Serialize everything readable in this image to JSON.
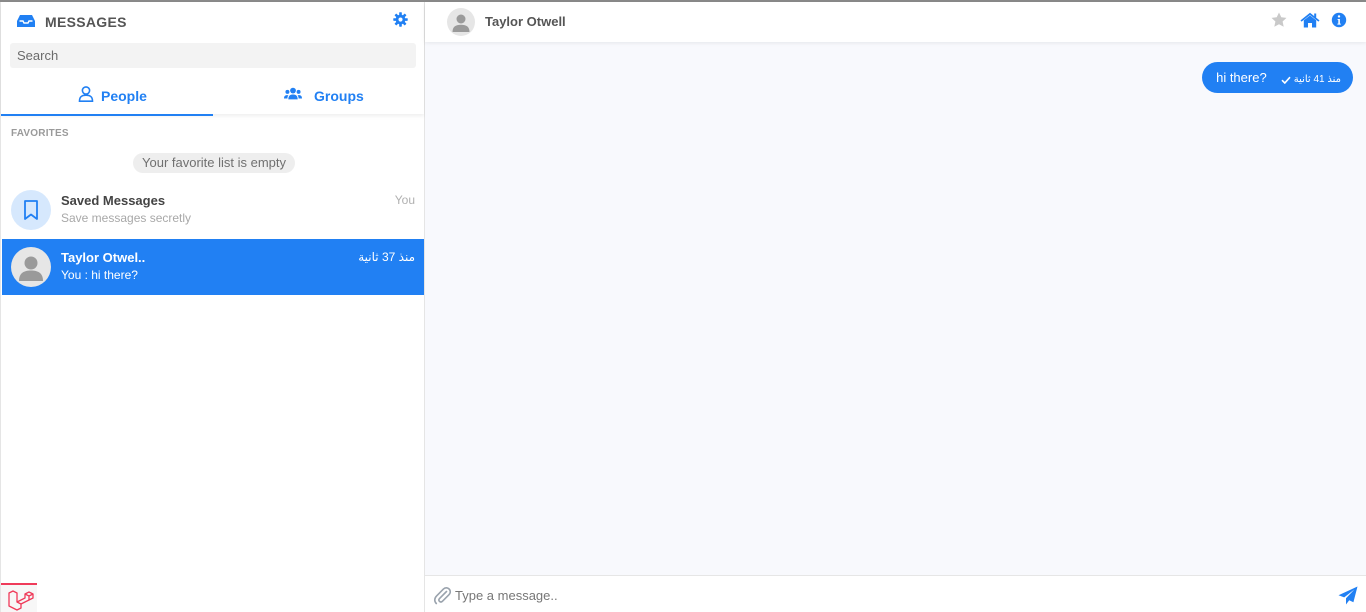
{
  "sidebar": {
    "title": "MESSAGES",
    "search_placeholder": "Search",
    "tabs": [
      {
        "label": "People",
        "icon": "user-icon",
        "active": true
      },
      {
        "label": "Groups",
        "icon": "users-icon",
        "active": false
      }
    ],
    "favorites_label": "FAVORITES",
    "favorites_empty": "Your favorite list is empty",
    "contacts": [
      {
        "name": "Saved Messages",
        "subtitle": "Save messages secretly",
        "time": "You",
        "icon": "bookmark-icon"
      },
      {
        "name": "Taylor Otwel..",
        "subtitle": "You : hi there?",
        "time": "منذ 37 ثانية",
        "active": true,
        "icon": "avatar-icon"
      }
    ]
  },
  "chat": {
    "contact_name": "Taylor Otwell",
    "header_icons": [
      "star-icon",
      "home-icon",
      "info-icon"
    ],
    "messages": [
      {
        "text": "hi there?",
        "time": "منذ 41 ثانية",
        "status": "sent",
        "from_me": true
      }
    ],
    "input_placeholder": "Type a message.."
  },
  "colors": {
    "accent": "#2180f3",
    "chat_background": "#f8f9fd",
    "saved_avatar_bg": "#d6e8fd",
    "laravel_red": "#ef3b5a"
  }
}
